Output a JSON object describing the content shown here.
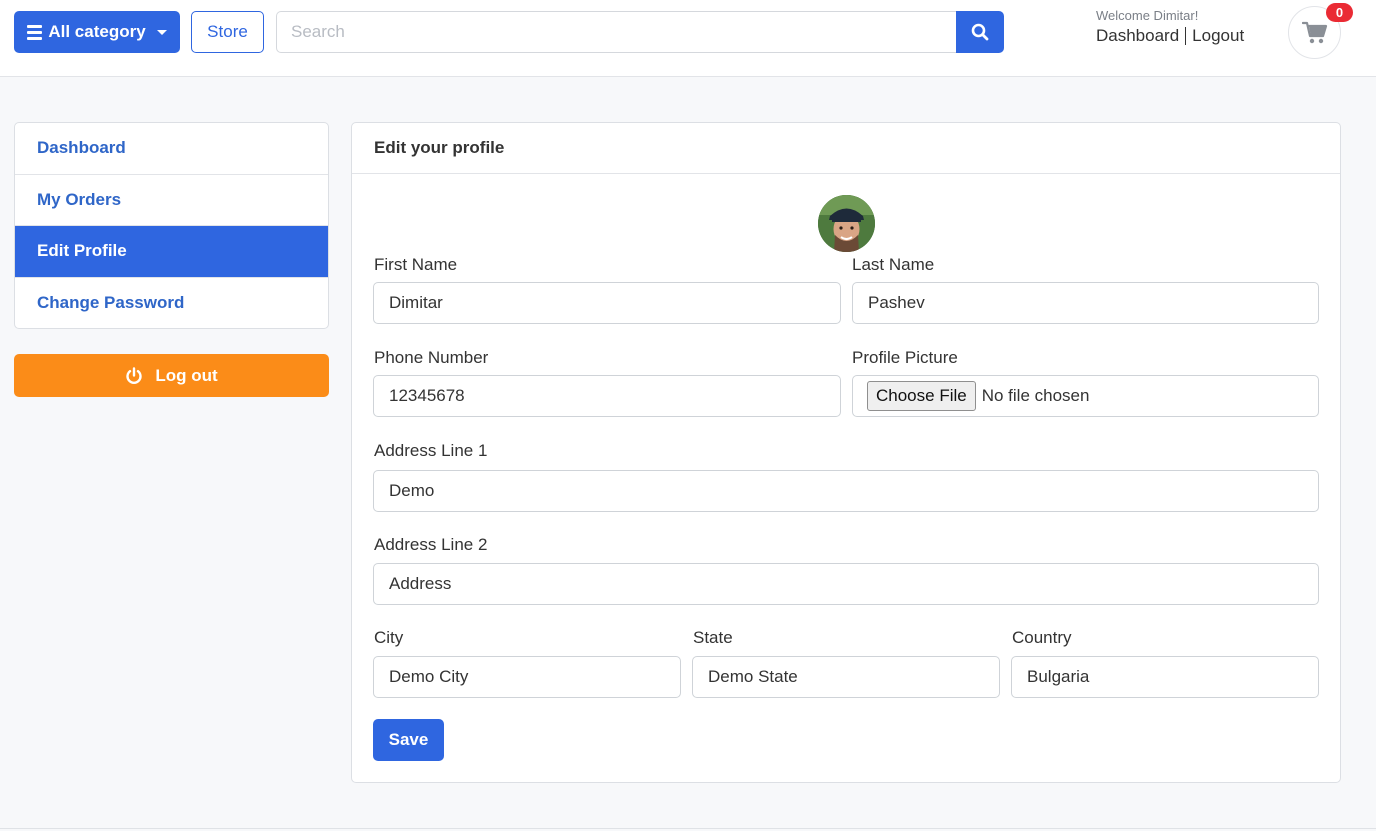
{
  "header": {
    "category_button": "All category",
    "store_button": "Store",
    "search": {
      "placeholder": "Search",
      "value": ""
    },
    "welcome": "Welcome Dimitar!",
    "dashboard_link": "Dashboard",
    "logout_link": "Logout",
    "cart_count": "0"
  },
  "sidebar": {
    "items": [
      {
        "label": "Dashboard",
        "active": false
      },
      {
        "label": "My Orders",
        "active": false
      },
      {
        "label": "Edit Profile",
        "active": true
      },
      {
        "label": "Change Password",
        "active": false
      }
    ],
    "logout_button": "Log out"
  },
  "profile_form": {
    "title": "Edit your profile",
    "first_name": {
      "label": "First Name",
      "value": "Dimitar"
    },
    "last_name": {
      "label": "Last Name",
      "value": "Pashev"
    },
    "phone": {
      "label": "Phone Number",
      "value": "12345678"
    },
    "picture": {
      "label": "Profile Picture",
      "button": "Choose File",
      "status": "No file chosen"
    },
    "address1": {
      "label": "Address Line 1",
      "value": "Demo"
    },
    "address2": {
      "label": "Address Line 2",
      "value": "Address"
    },
    "city": {
      "label": "City",
      "value": "Demo City"
    },
    "state": {
      "label": "State",
      "value": "Demo State"
    },
    "country": {
      "label": "Country",
      "value": "Bulgaria"
    },
    "save_button": "Save"
  },
  "colors": {
    "primary": "#2f66e0",
    "logout": "#fb8c18",
    "badge": "#ea2b34"
  }
}
